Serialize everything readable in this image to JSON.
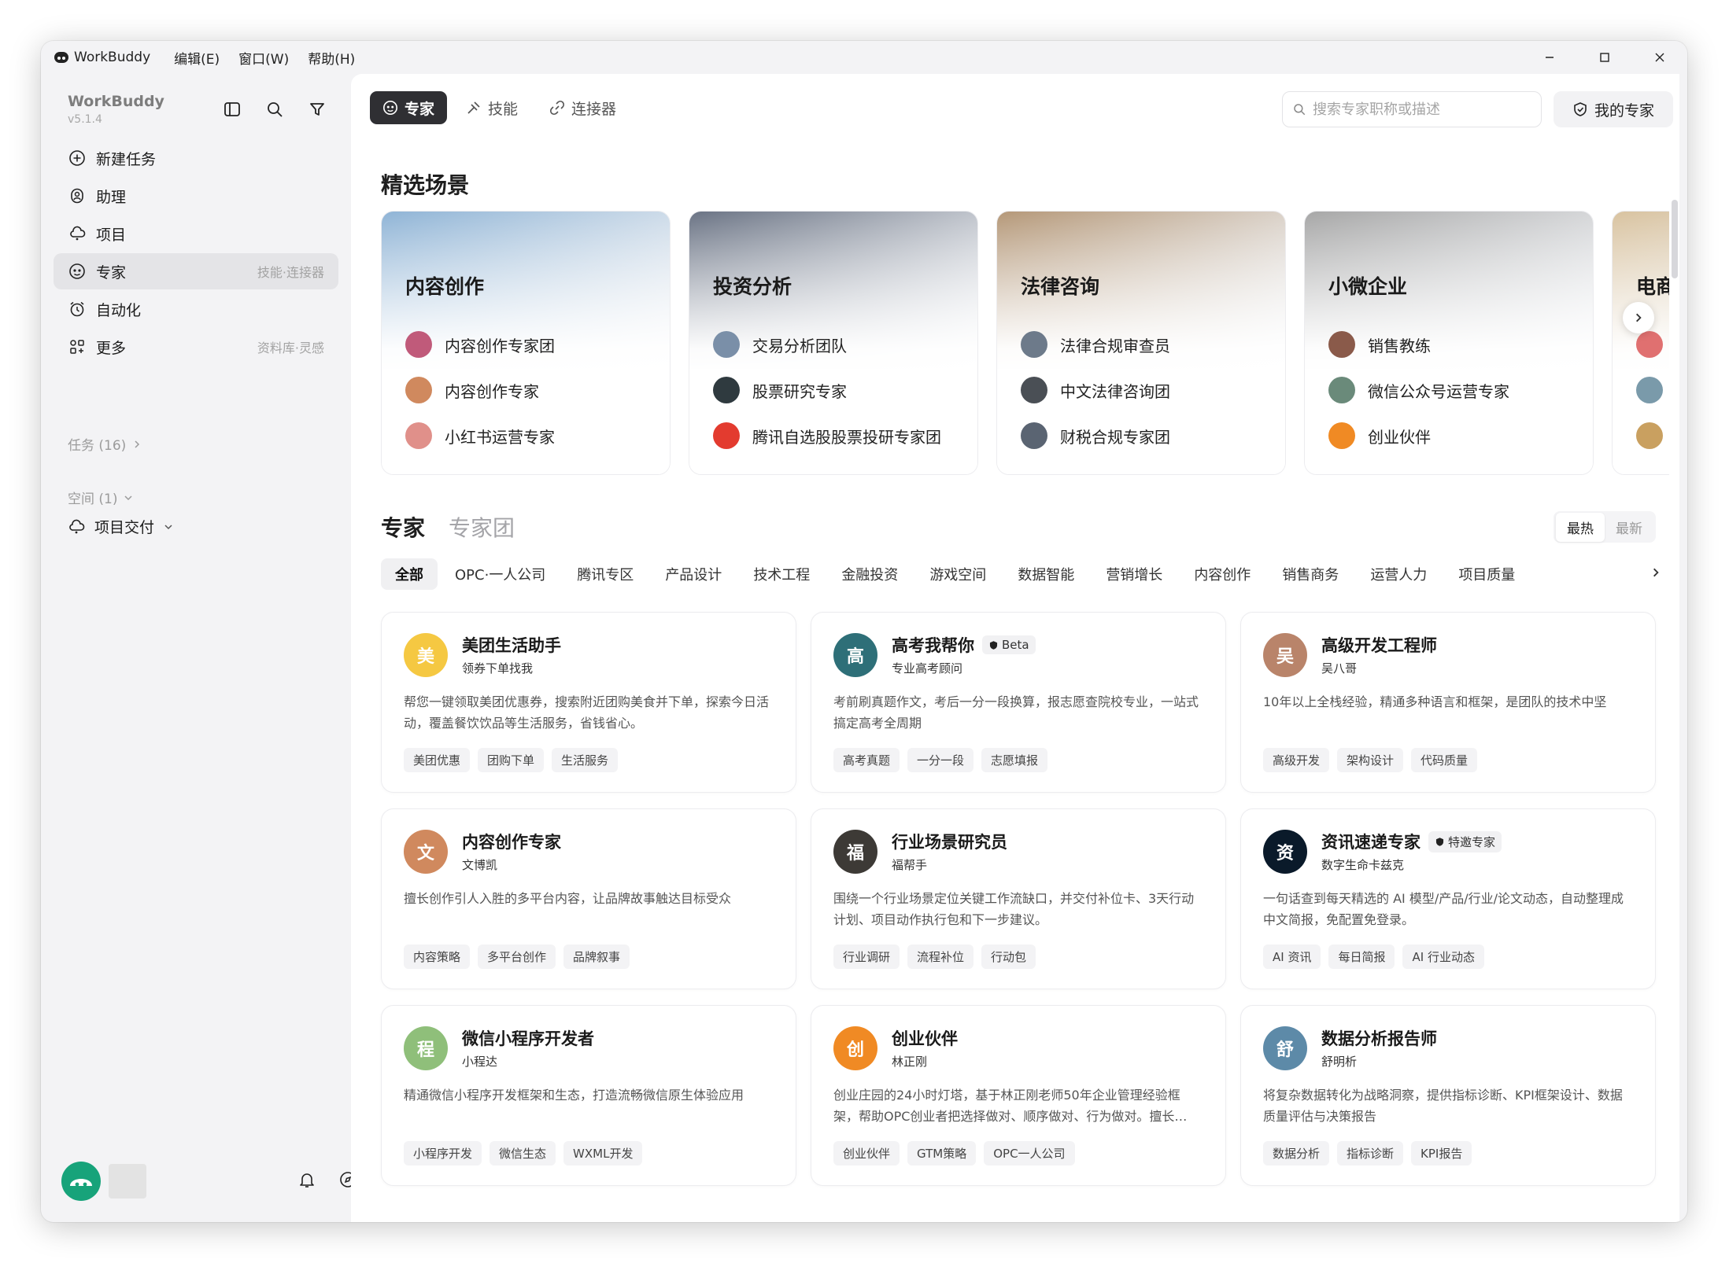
{
  "titlebar": {
    "app_name": "WorkBuddy",
    "menus": [
      "编辑(E)",
      "窗口(W)",
      "帮助(H)"
    ],
    "controls": [
      "minimize",
      "maximize",
      "close"
    ]
  },
  "sidebar": {
    "brand": "WorkBuddy",
    "version": "v5.1.4",
    "nav": [
      {
        "label": "新建任务",
        "icon": "plus-circle-icon",
        "sub": ""
      },
      {
        "label": "助理",
        "icon": "assistant-icon",
        "sub": ""
      },
      {
        "label": "项目",
        "icon": "project-icon",
        "sub": ""
      },
      {
        "label": "专家",
        "icon": "expert-icon",
        "sub": "技能·连接器",
        "active": true
      },
      {
        "label": "自动化",
        "icon": "alarm-icon",
        "sub": ""
      },
      {
        "label": "更多",
        "icon": "grid-icon",
        "sub": "资料库·灵感"
      }
    ],
    "tasks_label": "任务 (16)",
    "spaces_label": "空间 (1)",
    "project_label": "项目交付"
  },
  "main": {
    "tabs": [
      {
        "label": "专家",
        "active": true
      },
      {
        "label": "技能",
        "active": false
      },
      {
        "label": "连接器",
        "active": false
      }
    ],
    "search_placeholder": "搜索专家职称或描述",
    "my_experts": "我的专家",
    "featured_title": "精选场景",
    "scenes": [
      {
        "title": "内容创作",
        "accent": "#8fb4d6",
        "items": [
          {
            "label": "内容创作专家团",
            "color": "#c05a7a"
          },
          {
            "label": "内容创作专家",
            "color": "#d0895e"
          },
          {
            "label": "小红书运营专家",
            "color": "#e0908a"
          }
        ]
      },
      {
        "title": "投资分析",
        "accent": "#6a7384",
        "items": [
          {
            "label": "交易分析团队",
            "color": "#7a8fa8"
          },
          {
            "label": "股票研究专家",
            "color": "#2f3a3f"
          },
          {
            "label": "腾讯自选股股票投研专家团",
            "color": "#e33b2f"
          }
        ]
      },
      {
        "title": "法律咨询",
        "accent": "#b59878",
        "items": [
          {
            "label": "法律合规审查员",
            "color": "#6d7a8a"
          },
          {
            "label": "中文法律咨询团",
            "color": "#4a4f55"
          },
          {
            "label": "财税合规专家团",
            "color": "#5a6472"
          }
        ]
      },
      {
        "title": "小微企业",
        "accent": "#a7a7a7",
        "items": [
          {
            "label": "销售教练",
            "color": "#8a5a4a"
          },
          {
            "label": "微信公众号运营专家",
            "color": "#6a8a7a"
          },
          {
            "label": "创业伙伴",
            "color": "#f08a24"
          }
        ]
      },
      {
        "title": "电商",
        "accent": "#d9c3a0",
        "items": [
          {
            "label": "",
            "color": "#e07070"
          },
          {
            "label": "",
            "color": "#7a9aaa"
          },
          {
            "label": "",
            "color": "#c9a060"
          }
        ]
      }
    ],
    "experts_title": "专家",
    "teams_title": "专家团",
    "sort": [
      "最热",
      "最新"
    ],
    "categories": [
      "全部",
      "OPC·一人公司",
      "腾讯专区",
      "产品设计",
      "技术工程",
      "金融投资",
      "游戏空间",
      "数据智能",
      "营销增长",
      "内容创作",
      "销售商务",
      "运营人力",
      "项目质量"
    ],
    "experts": [
      {
        "name": "美团生活助手",
        "author": "领券下单找我",
        "badge": "",
        "color": "#f5c842",
        "initial": "美",
        "desc": "帮您一键领取美团优惠券，搜索附近团购美食并下单，探索今日活动，覆盖餐饮饮品等生活服务，省钱省心。",
        "tags": [
          "美团优惠",
          "团购下单",
          "生活服务"
        ]
      },
      {
        "name": "高考我帮你",
        "author": "专业高考顾问",
        "badge": "Beta",
        "color": "#2e6f78",
        "initial": "高",
        "desc": "考前刷真题作文，考后一分一段换算，报志愿查院校专业，一站式搞定高考全周期",
        "tags": [
          "高考真题",
          "一分一段",
          "志愿填报"
        ]
      },
      {
        "name": "高级开发工程师",
        "author": "吴八哥",
        "badge": "",
        "color": "#b9846a",
        "initial": "吴",
        "desc": "10年以上全栈经验，精通多种语言和框架，是团队的技术中坚",
        "tags": [
          "高级开发",
          "架构设计",
          "代码质量"
        ]
      },
      {
        "name": "内容创作专家",
        "author": "文博凯",
        "badge": "",
        "color": "#d0895e",
        "initial": "文",
        "desc": "擅长创作引人入胜的多平台内容，让品牌故事触达目标受众",
        "tags": [
          "内容策略",
          "多平台创作",
          "品牌叙事"
        ]
      },
      {
        "name": "行业场景研究员",
        "author": "福帮手",
        "badge": "",
        "color": "#3d3a36",
        "initial": "福",
        "desc": "围绕一个行业场景定位关键工作流缺口，并交付补位卡、3天行动计划、项目动作执行包和下一步建议。",
        "tags": [
          "行业调研",
          "流程补位",
          "行动包"
        ]
      },
      {
        "name": "资讯速递专家",
        "author": "数字生命卡兹克",
        "badge": "特邀专家",
        "color": "#0a1a2a",
        "initial": "资",
        "desc": "一句话查到每天精选的 AI 模型/产品/行业/论文动态，自动整理成中文简报，免配置免登录。",
        "tags": [
          "AI 资讯",
          "每日简报",
          "AI 行业动态"
        ]
      },
      {
        "name": "微信小程序开发者",
        "author": "小程达",
        "badge": "",
        "color": "#8fbf7a",
        "initial": "程",
        "desc": "精通微信小程序开发框架和生态，打造流畅微信原生体验应用",
        "tags": [
          "小程序开发",
          "微信生态",
          "WXML开发"
        ]
      },
      {
        "name": "创业伙伴",
        "author": "林正刚",
        "badge": "",
        "color": "#f08a24",
        "initial": "创",
        "desc": "创业庄园的24小时灯塔，基于林正刚老师50年企业管理经验框架，帮助OPC创业者把选择做对、顺序做对、行为做对。擅长…",
        "tags": [
          "创业伙伴",
          "GTM策略",
          "OPC一人公司"
        ]
      },
      {
        "name": "数据分析报告师",
        "author": "舒明析",
        "badge": "",
        "color": "#5d8aa8",
        "initial": "舒",
        "desc": "将复杂数据转化为战略洞察，提供指标诊断、KPI框架设计、数据质量评估与决策报告",
        "tags": [
          "数据分析",
          "指标诊断",
          "KPI报告"
        ]
      }
    ]
  }
}
